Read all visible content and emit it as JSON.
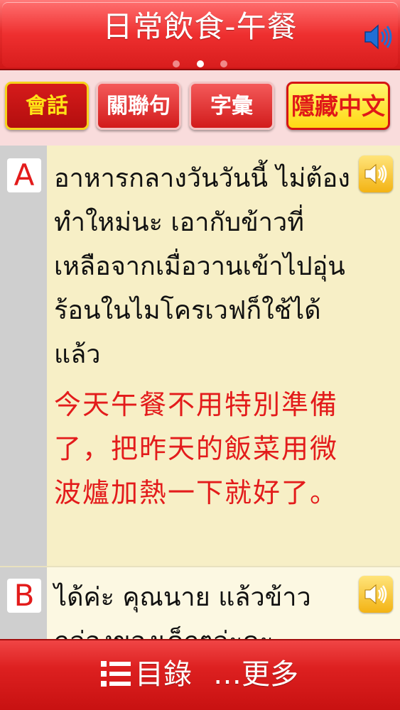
{
  "header": {
    "title": "日常飲食-午餐",
    "speaker_icon": "speaker-icon",
    "page_dots": 3,
    "active_dot": 2
  },
  "tabs": [
    {
      "label": "會話",
      "state": "active"
    },
    {
      "label": "關聯句",
      "state": "normal"
    },
    {
      "label": "字彙",
      "state": "normal"
    },
    {
      "label": "隱藏中文",
      "state": "highlight"
    }
  ],
  "messages": [
    {
      "speaker": "A",
      "thai": "อาหารกลางวันวันนี้ ไม่ต้องทำใหม่นะ เอากับข้าวที่เหลือจากเมื่อวานเข้าไปอุ่นร้อนในไมโครเวฟก็ใช้ได้แล้ว",
      "chinese": "今天午餐不用特別準備了，把昨天的飯菜用微波爐加熱一下就好了。"
    },
    {
      "speaker": "B",
      "thai": "ได้ค่ะ คุณนาย แล้วข้าวกล่องของเด็กๆล่ะคะ"
    }
  ],
  "footer": {
    "menu_label": "目錄",
    "more_label": "更多",
    "more_prefix": "…"
  },
  "colors": {
    "header_red": "#e62d2d",
    "accent_yellow": "#ffe317",
    "chinese_red": "#e31b1b",
    "content_bg": "#f7efc6"
  }
}
